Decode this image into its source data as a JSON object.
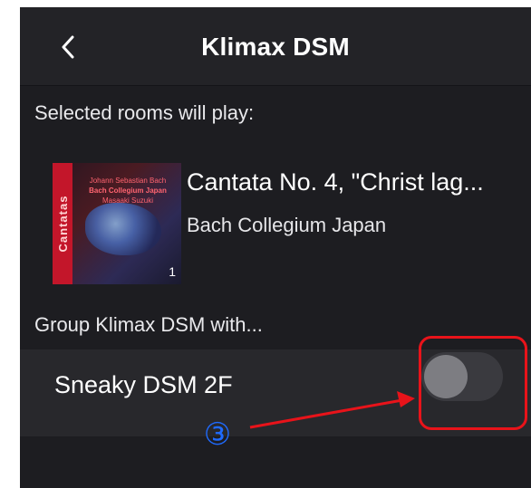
{
  "nav": {
    "title": "Klimax DSM",
    "back_icon": "chevron-left-icon"
  },
  "sections": {
    "play_label": "Selected rooms will play:",
    "group_label": "Group Klimax DSM with..."
  },
  "now_playing": {
    "title": "Cantata No. 4, \"Christ lag...",
    "artist": "Bach Collegium Japan",
    "album_art": {
      "vertical_text": "Cantatas",
      "top_line1": "Johann Sebastian Bach",
      "top_line2": "Bach Collegium Japan",
      "top_line3": "Masaaki Suzuki",
      "number": "1"
    }
  },
  "rooms": [
    {
      "name": "Sneaky DSM 2F",
      "grouped": false
    }
  ],
  "annotation": {
    "step_marker": "③",
    "highlight_color": "#e8131a",
    "marker_color": "#1f6bff"
  },
  "colors": {
    "background": "#1d1d21",
    "nav_background": "#232327",
    "row_background": "#28282c",
    "toggle_off_track": "#3a3a3f",
    "toggle_knob": "#7d7d82"
  }
}
